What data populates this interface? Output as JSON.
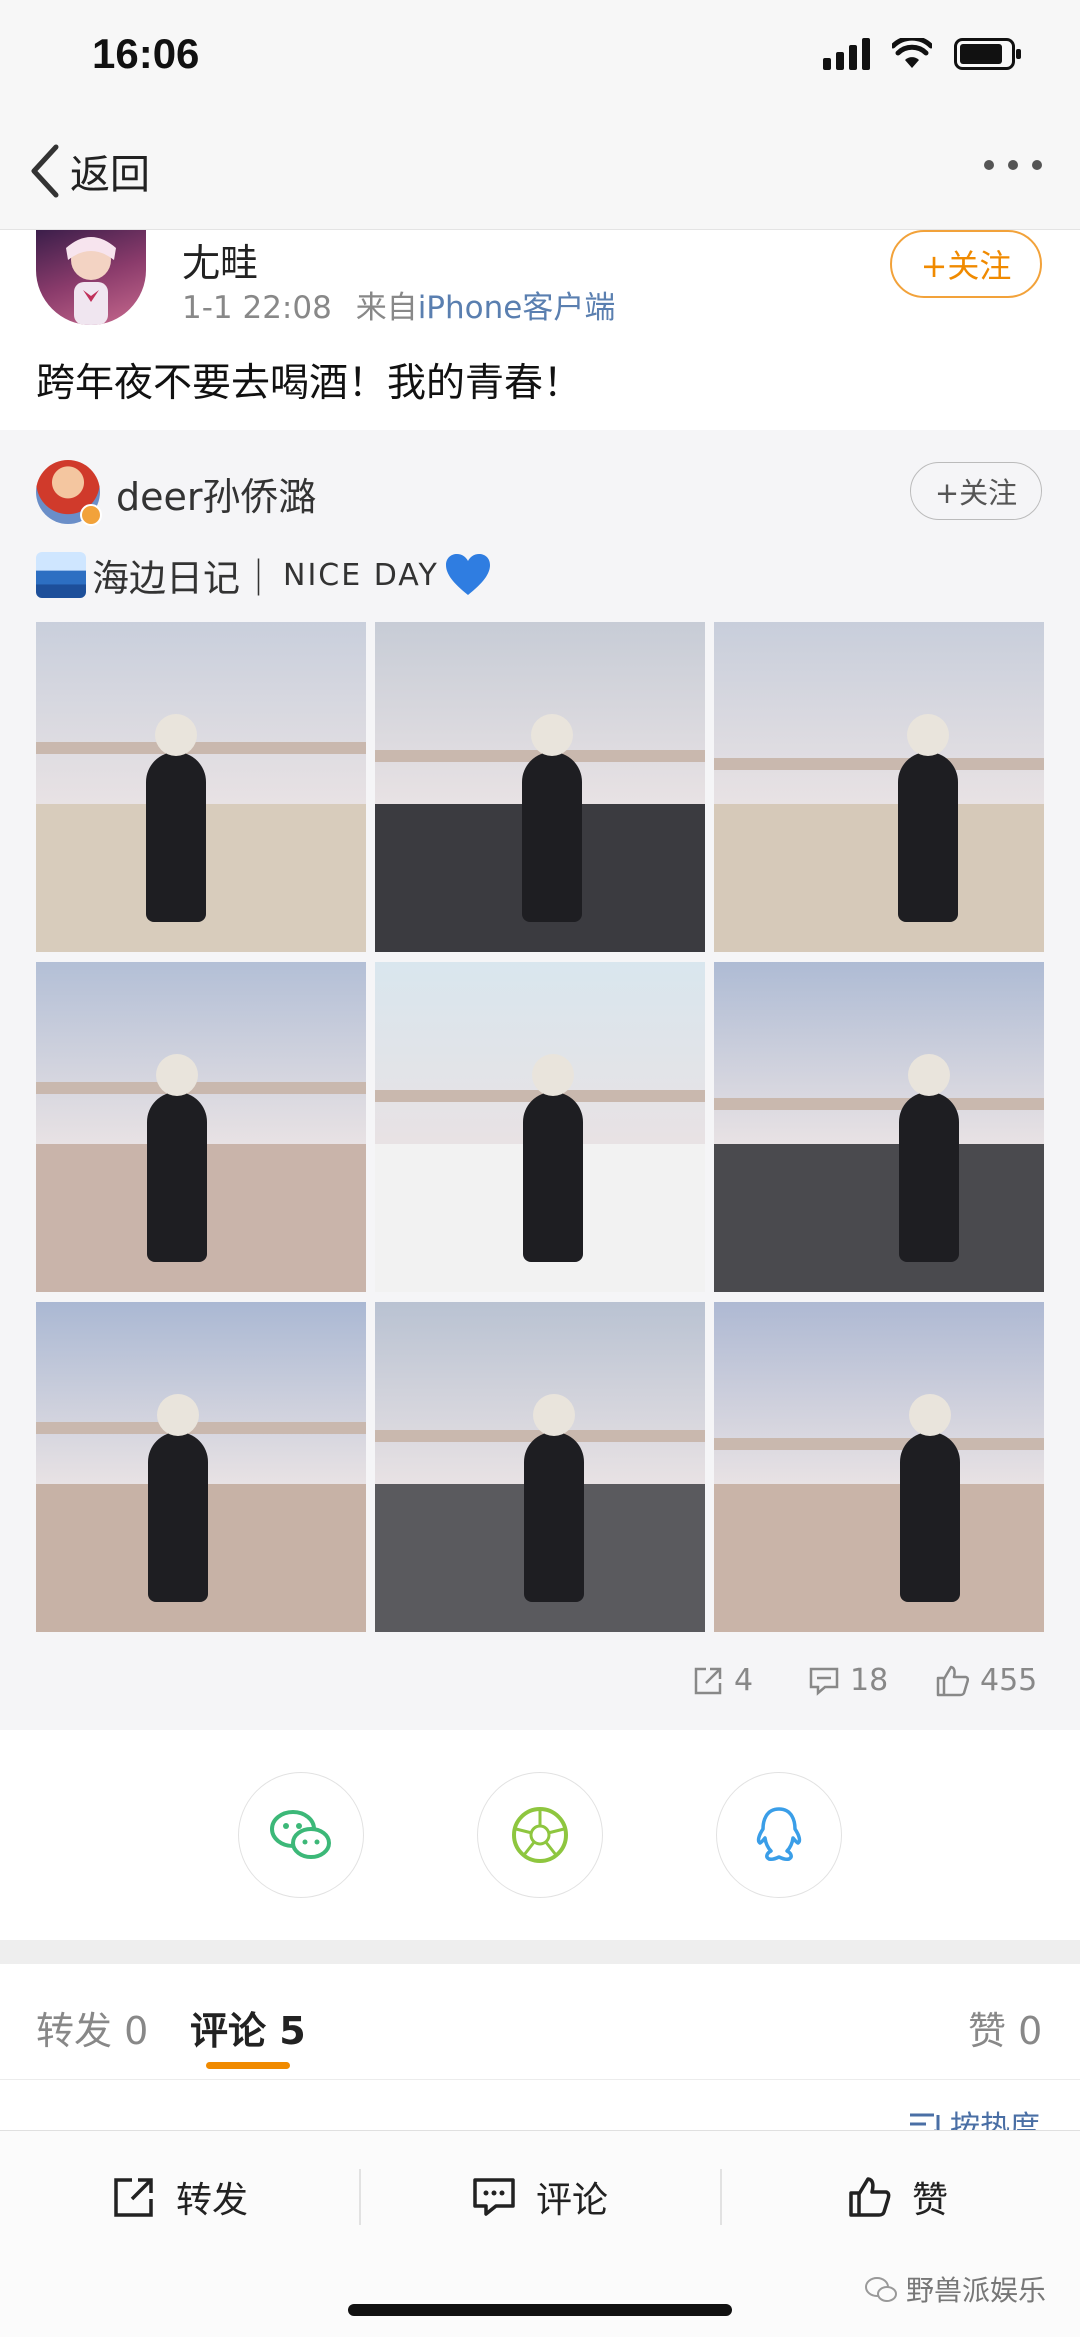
{
  "status_bar": {
    "time": "16:06"
  },
  "nav": {
    "back_label": "返回"
  },
  "post": {
    "author": "尢畦",
    "time": "1-1 22:08",
    "source_prefix": "来自",
    "source": "iPhone客户端",
    "follow_label": "+关注",
    "text": "跨年夜不要去喝酒！我的青春！"
  },
  "original": {
    "author": "deer孙侨潞",
    "follow_label": "+关注",
    "text_main": "海边日记｜",
    "text_tail": "NICE DAY",
    "photos": [
      {
        "sky": "#c9cfdc",
        "ground": "#d8ccbc"
      },
      {
        "sky": "#c7ccd6",
        "ground": "#3b3b40"
      },
      {
        "sky": "#c8cedb",
        "ground": "#d6c9b9"
      },
      {
        "sky": "#b3bfd6",
        "ground": "#c9b4aa"
      },
      {
        "sky": "#d9e6ee",
        "ground": "#f2f2f2"
      },
      {
        "sky": "#aebbd4",
        "ground": "#4a4a4e"
      },
      {
        "sky": "#aab8d3",
        "ground": "#c7b2a6"
      },
      {
        "sky": "#b9c2d2",
        "ground": "#5a5a5e"
      },
      {
        "sky": "#aeb9d3",
        "ground": "#c9b4a8"
      }
    ]
  },
  "stats": {
    "reposts": "4",
    "comments": "18",
    "likes": "455"
  },
  "tabs": {
    "repost": "转发 0",
    "comment": "评论 5",
    "like": "赞 0"
  },
  "sort": {
    "label": "按热度"
  },
  "bottom": {
    "repost": "转发",
    "comment": "评论",
    "like": "赞"
  },
  "watermark": "野兽派娱乐",
  "colors": {
    "accent": "#f08a00",
    "link": "#5a7fb0"
  }
}
